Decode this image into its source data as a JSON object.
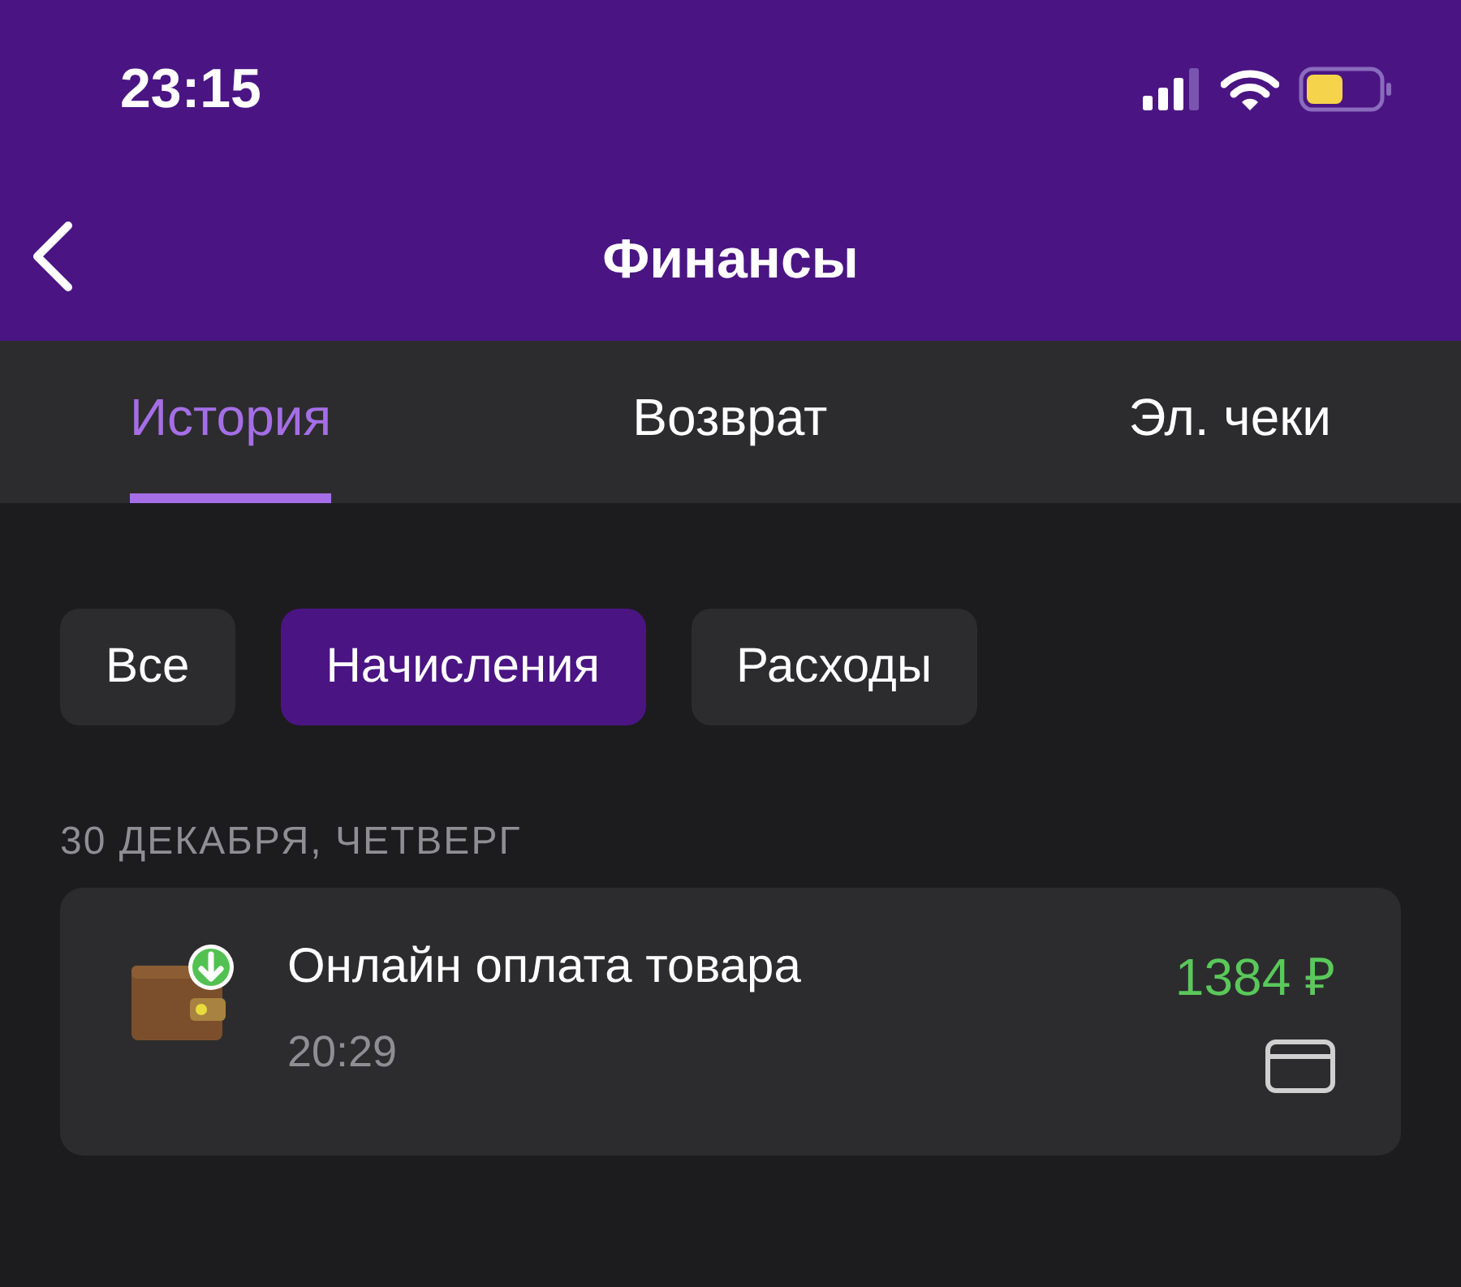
{
  "status_bar": {
    "time": "23:15"
  },
  "header": {
    "title": "Финансы"
  },
  "tabs": [
    {
      "label": "История",
      "selected": true
    },
    {
      "label": "Возврат",
      "selected": false
    },
    {
      "label": "Эл. чеки",
      "selected": false
    }
  ],
  "filters": [
    {
      "label": "Все",
      "selected": false
    },
    {
      "label": "Начисления",
      "selected": true
    },
    {
      "label": "Расходы",
      "selected": false
    }
  ],
  "groups": [
    {
      "date": "30 ДЕКАБРЯ, ЧЕТВЕРГ",
      "transactions": [
        {
          "title": "Онлайн оплата товара",
          "time": "20:29",
          "amount": "1384 ₽"
        }
      ]
    }
  ]
}
